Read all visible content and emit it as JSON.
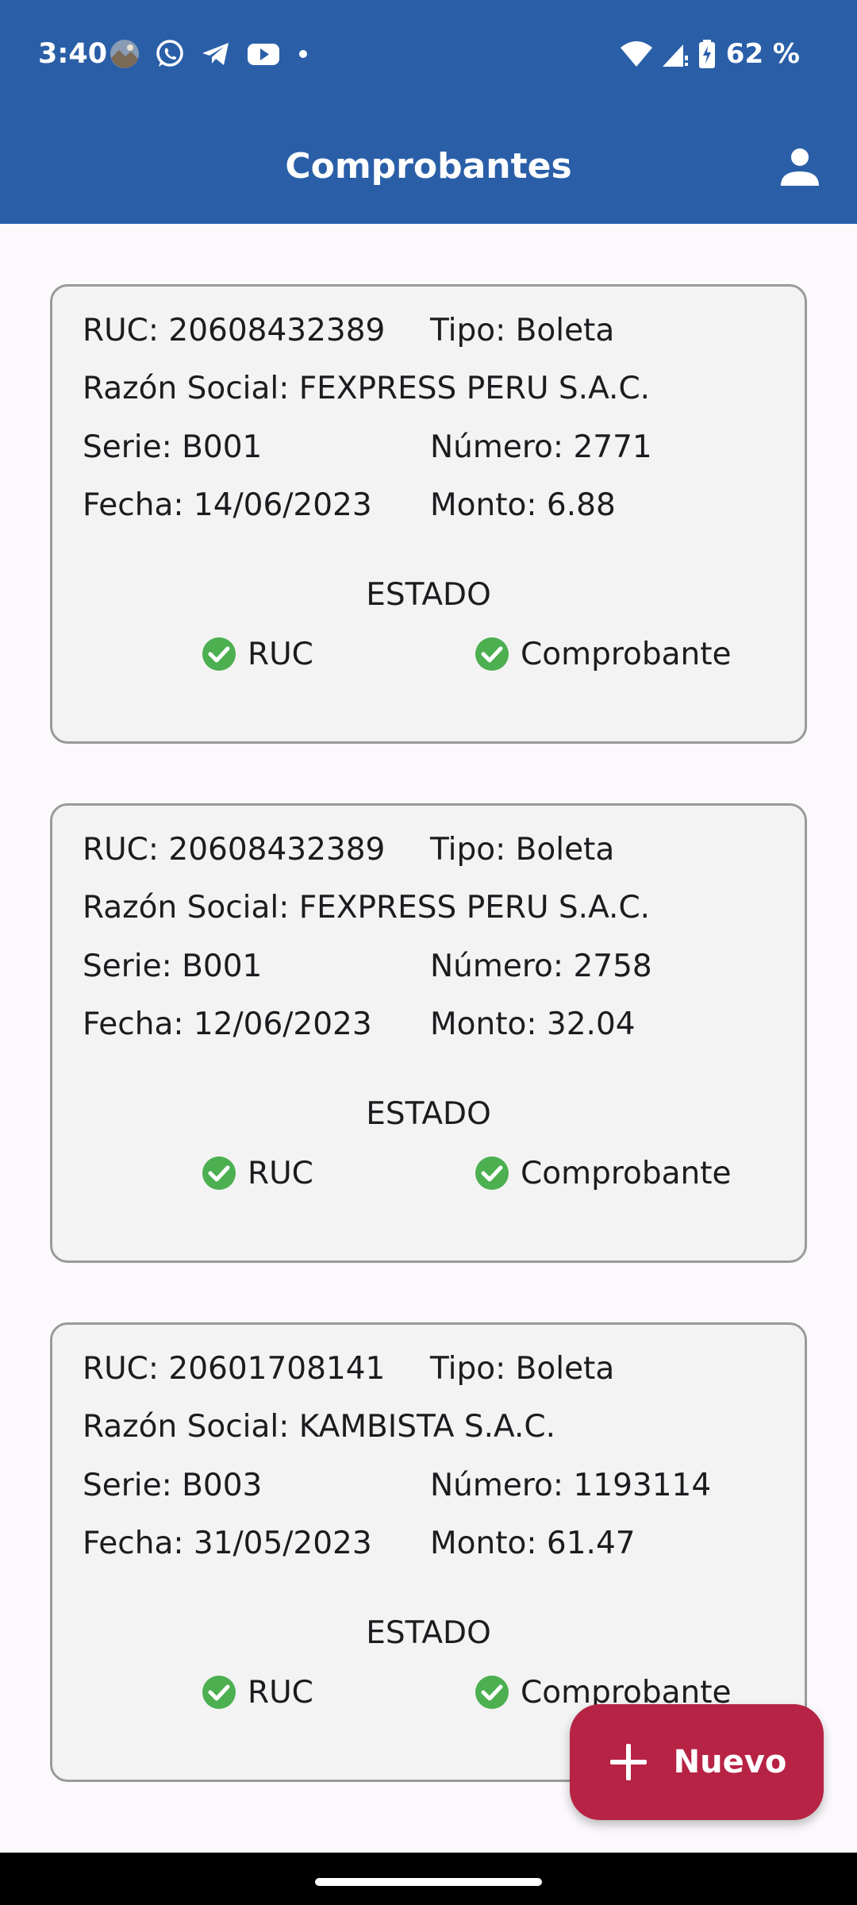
{
  "status_bar": {
    "time": "3:40",
    "battery": "62 %",
    "icons": [
      "photo-avatar-icon",
      "whatsapp-icon",
      "telegram-icon",
      "youtube-icon",
      "dot-icon",
      "wifi-icon",
      "signal-icon",
      "battery-charging-icon"
    ]
  },
  "header": {
    "title": "Comprobantes",
    "profile_icon": "person-icon"
  },
  "colors": {
    "app_bar": "#2a5fa8",
    "fab": "#b72345",
    "check": "#4caf50",
    "card_bg": "#f3f3f3"
  },
  "cards": [
    {
      "ruc": "RUC: 20608432389",
      "tipo": "Tipo: Boleta",
      "razon_social": "Razón Social: FEXPRESS PERU S.A.C.",
      "serie": "Serie: B001",
      "numero": "Número: 2771",
      "fecha": "Fecha: 14/06/2023",
      "monto": "Monto: 6.88",
      "estado_title": "ESTADO",
      "estado_ruc": "RUC",
      "estado_comprobante": "Comprobante"
    },
    {
      "ruc": "RUC: 20608432389",
      "tipo": "Tipo: Boleta",
      "razon_social": "Razón Social: FEXPRESS PERU S.A.C.",
      "serie": "Serie: B001",
      "numero": "Número: 2758",
      "fecha": "Fecha: 12/06/2023",
      "monto": "Monto: 32.04",
      "estado_title": "ESTADO",
      "estado_ruc": "RUC",
      "estado_comprobante": "Comprobante"
    },
    {
      "ruc": "RUC: 20601708141",
      "tipo": "Tipo: Boleta",
      "razon_social": "Razón Social: KAMBISTA S.A.C.",
      "serie": "Serie: B003",
      "numero": "Número: 1193114",
      "fecha": "Fecha: 31/05/2023",
      "monto": "Monto: 61.47",
      "estado_title": "ESTADO",
      "estado_ruc": "RUC",
      "estado_comprobante": "Comprobante"
    }
  ],
  "fab": {
    "label": "Nuevo",
    "icon": "plus-icon"
  }
}
